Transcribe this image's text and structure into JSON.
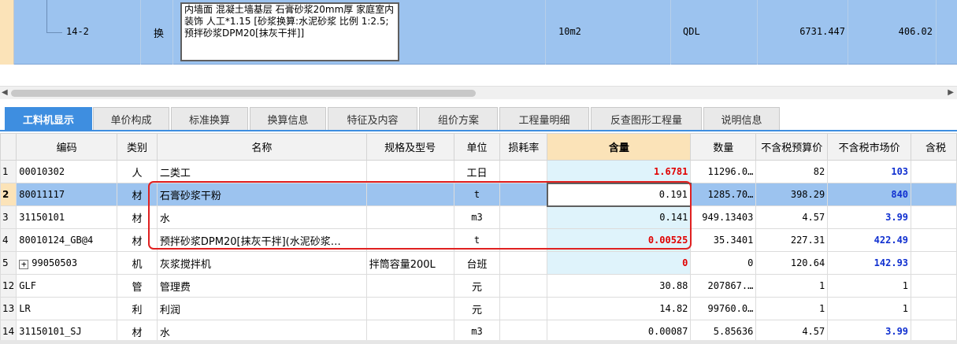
{
  "top_row": {
    "code": "14-2",
    "type": "换",
    "name": "内墙面 混凝土墙基层 石膏砂浆20mm厚 家庭室内装饰 人工*1.15  [砂浆换算:水泥砂浆 比例 1:2.5;预拌砂浆DPM20[抹灰干拌]]",
    "unit": "10m2",
    "qdl": "QDL",
    "quantity": "6731.447",
    "price": "406.02"
  },
  "tabs": [
    {
      "label": "工料机显示",
      "active": true
    },
    {
      "label": "单价构成"
    },
    {
      "label": "标准换算"
    },
    {
      "label": "换算信息"
    },
    {
      "label": "特征及内容"
    },
    {
      "label": "组价方案"
    },
    {
      "label": "工程量明细"
    },
    {
      "label": "反查图形工程量"
    },
    {
      "label": "说明信息"
    }
  ],
  "columns": [
    "编码",
    "类别",
    "名称",
    "规格及型号",
    "单位",
    "损耗率",
    "含量",
    "数量",
    "不含税预算价",
    "不含税市场价",
    "含税"
  ],
  "rows": [
    {
      "num": "1",
      "code": "00010302",
      "type": "人",
      "name": "二类工",
      "spec": "",
      "unit": "工日",
      "loss": "",
      "hanl": "1.6781",
      "qty": "11296.0…",
      "budget": "82",
      "market": "103"
    },
    {
      "num": "2",
      "code": "80011117",
      "type": "材",
      "name": "石膏砂浆干粉",
      "spec": "",
      "unit": "t",
      "loss": "",
      "hanl": "0.191",
      "qty": "1285.70…",
      "budget": "398.29",
      "market": "840"
    },
    {
      "num": "3",
      "code": "31150101",
      "type": "材",
      "name": "水",
      "spec": "",
      "unit": "m3",
      "loss": "",
      "hanl": "0.141",
      "qty": "949.13403",
      "budget": "4.57",
      "market": "3.99"
    },
    {
      "num": "4",
      "code": "80010124_GB@4",
      "type": "材",
      "name": "预拌砂浆DPM20[抹灰干拌](水泥砂浆…",
      "spec": "",
      "unit": "t",
      "loss": "",
      "hanl": "0.00525",
      "qty": "35.3401",
      "budget": "227.31",
      "market": "422.49"
    },
    {
      "num": "5",
      "code": "99050503",
      "type": "机",
      "name": "灰浆搅拌机",
      "spec": "拌筒容量200L",
      "unit": "台班",
      "loss": "",
      "hanl": "0",
      "qty": "0",
      "budget": "120.64",
      "market": "142.93"
    },
    {
      "num": "12",
      "code": "GLF",
      "type": "管",
      "name": "管理费",
      "spec": "",
      "unit": "元",
      "loss": "",
      "hanl": "30.88",
      "qty": "207867.…",
      "budget": "1",
      "market": "1"
    },
    {
      "num": "13",
      "code": "LR",
      "type": "利",
      "name": "利润",
      "spec": "",
      "unit": "元",
      "loss": "",
      "hanl": "14.82",
      "qty": "99760.0…",
      "budget": "1",
      "market": "1"
    },
    {
      "num": "14",
      "code": "31150101_SJ",
      "type": "材",
      "name": "水",
      "spec": "",
      "unit": "m3",
      "loss": "",
      "hanl": "0.00087",
      "qty": "5.85636",
      "budget": "4.57",
      "market": "3.99"
    }
  ],
  "icons": {
    "expand": "+",
    "scroll_left": "◀",
    "scroll_right": "▶"
  },
  "colors": {
    "accent": "#3e8ee0",
    "selected_row": "#9cc3ef",
    "highlight": "#e00000",
    "market_price": "#1030d0"
  }
}
